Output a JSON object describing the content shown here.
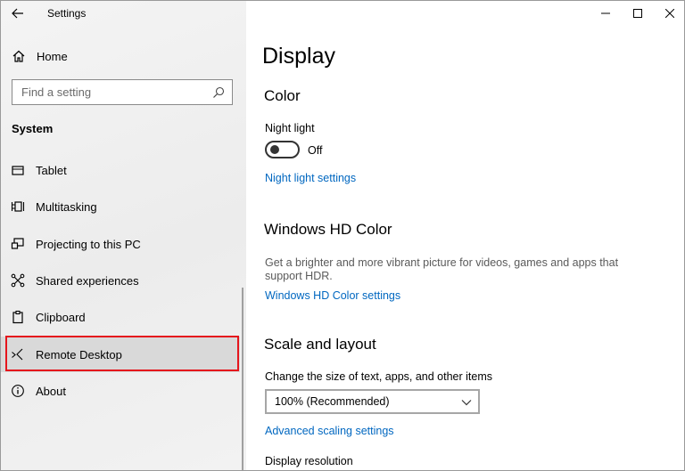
{
  "window": {
    "title": "Settings"
  },
  "sidebar": {
    "home_label": "Home",
    "search_placeholder": "Find a setting",
    "section_title": "System",
    "items": [
      {
        "label": "Tablet",
        "icon": "tablet-icon"
      },
      {
        "label": "Multitasking",
        "icon": "multitasking-icon"
      },
      {
        "label": "Projecting to this PC",
        "icon": "projecting-icon"
      },
      {
        "label": "Shared experiences",
        "icon": "shared-experiences-icon"
      },
      {
        "label": "Clipboard",
        "icon": "clipboard-icon"
      },
      {
        "label": "Remote Desktop",
        "icon": "remote-desktop-icon"
      },
      {
        "label": "About",
        "icon": "info-icon"
      }
    ],
    "selected_item": "Remote Desktop"
  },
  "main": {
    "page_title": "Display",
    "color": {
      "heading": "Color",
      "night_light_label": "Night light",
      "night_light_state": "Off",
      "night_light_on": false,
      "night_light_settings_link": "Night light settings"
    },
    "hd_color": {
      "heading": "Windows HD Color",
      "description": "Get a brighter and more vibrant picture for videos, games and apps that support HDR.",
      "settings_link": "Windows HD Color settings"
    },
    "scale": {
      "heading": "Scale and layout",
      "size_label": "Change the size of text, apps, and other items",
      "size_value": "100% (Recommended)",
      "advanced_link": "Advanced scaling settings",
      "resolution_label": "Display resolution"
    }
  },
  "colors": {
    "accent_link": "#0067c0",
    "highlight_border": "#e5151c",
    "sidebar_bg": "#f2f2f2"
  }
}
